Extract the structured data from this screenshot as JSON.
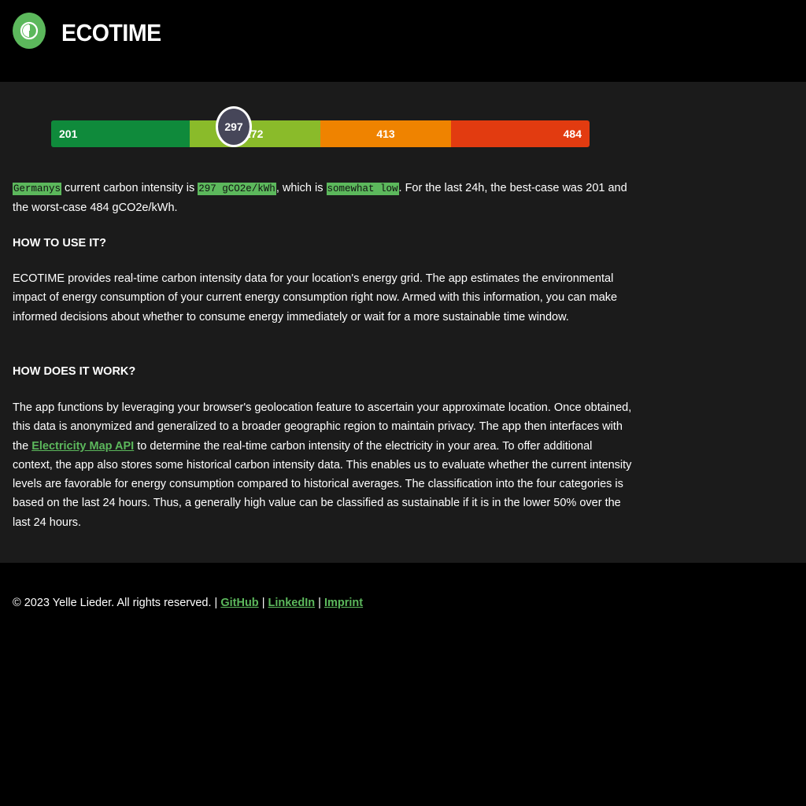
{
  "app": {
    "title": "ECOTIME"
  },
  "colors": {
    "accent": "#5cb85c",
    "scale_low": "#0f8a3b",
    "scale_somewhat_low": "#8abb2a",
    "scale_somewhat_high": "#ef8300",
    "scale_high": "#e23b10",
    "marker": "#464659"
  },
  "scale": {
    "min": 201,
    "max": 484,
    "current": 297,
    "segments": [
      {
        "label": "201",
        "align": "left"
      },
      {
        "label": "272",
        "align": "left"
      },
      {
        "label": "413",
        "align": "center"
      },
      {
        "label": "484",
        "align": "right"
      }
    ],
    "marker_label": "297"
  },
  "summary": {
    "country": "Germanys",
    "text1": " current carbon intensity is ",
    "intensity": "297 gCO2e/kWh",
    "text2": ", which is ",
    "category": "somewhat low",
    "text3": ". For the last 24h, the best-case was 201 and the worst-case 484 gCO2e/kWh."
  },
  "how_to_use": {
    "heading": "HOW TO USE IT?",
    "body": "ECOTIME provides real-time carbon intensity data for your location's energy grid. The app estimates the environmental impact of energy consumption of your current energy consumption right now. Armed with this information, you can make informed decisions about whether to consume energy immediately or wait for a more sustainable time window."
  },
  "how_it_works": {
    "heading": "HOW DOES IT WORK?",
    "body_before_link": "The app functions by leveraging your browser's geolocation feature to ascertain your approximate location. Once obtained, this data is anonymized and generalized to a broader geographic region to maintain privacy. The app then interfaces with the ",
    "link_label": "Electricity Map API",
    "body_after_link": " to determine the real-time carbon intensity of the electricity in your area. To offer additional context, the app also stores some historical carbon intensity data. This enables us to evaluate whether the current intensity levels are favorable for energy consumption compared to historical averages. The classification into the four categories is based on the last 24 hours. Thus, a generally high value can be classified as sustainable if it is in the lower 50% over the last 24 hours."
  },
  "footer": {
    "copyright": "© 2023 Yelle Lieder. All rights reserved. | ",
    "sep": " | ",
    "links": [
      "GitHub",
      "LinkedIn",
      "Imprint"
    ]
  }
}
